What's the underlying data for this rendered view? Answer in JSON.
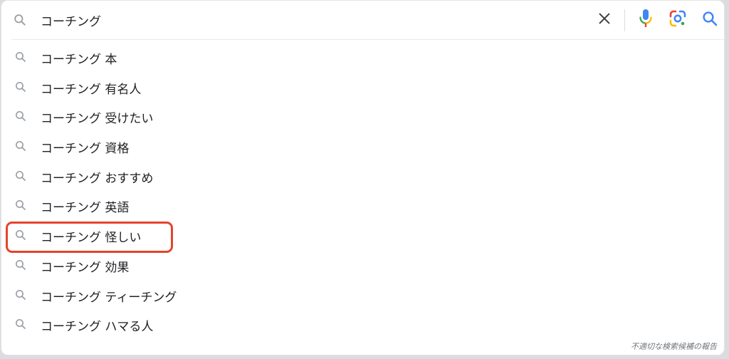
{
  "search": {
    "query": "コーチング",
    "clear_icon": "close-icon",
    "voice_icon": "microphone-icon",
    "lens_icon": "google-lens-icon",
    "search_icon": "search-icon"
  },
  "suggestions": [
    {
      "text": "コーチング 本"
    },
    {
      "text": "コーチング 有名人"
    },
    {
      "text": "コーチング 受けたい"
    },
    {
      "text": "コーチング 資格"
    },
    {
      "text": "コーチング おすすめ"
    },
    {
      "text": "コーチング 英語"
    },
    {
      "text": "コーチング 怪しい"
    },
    {
      "text": "コーチング 効果"
    },
    {
      "text": "コーチング ティーチング"
    },
    {
      "text": "コーチング ハマる人"
    }
  ],
  "highlighted_suggestion_index": 6,
  "footer": {
    "report_label": "不適切な検索候補の報告"
  },
  "colors": {
    "highlight": "#e5432c",
    "icon_gray": "#9aa0a6",
    "google_blue": "#4285f4",
    "google_red": "#ea4335",
    "google_yellow": "#fbbc04",
    "google_green": "#34a853"
  }
}
